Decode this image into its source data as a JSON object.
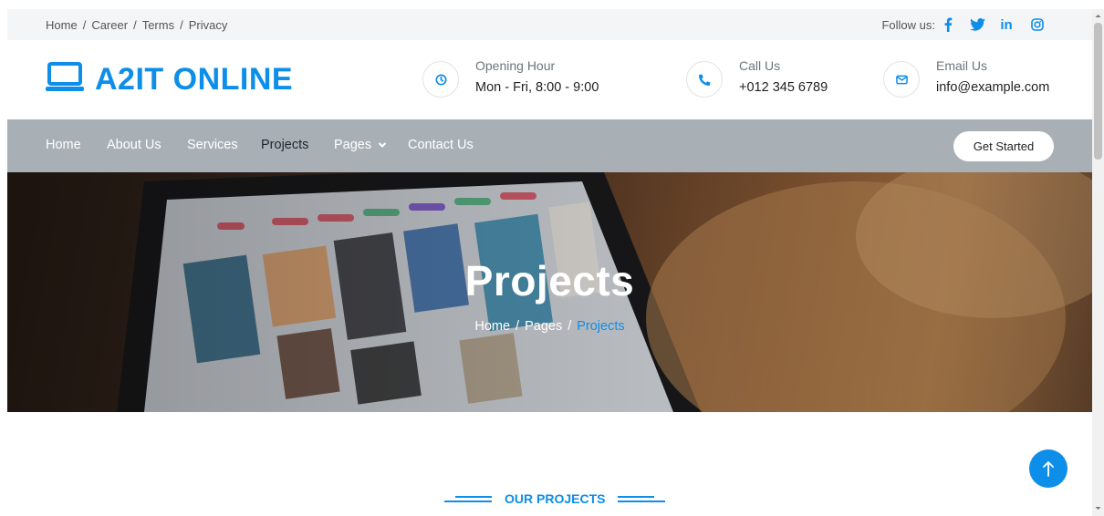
{
  "topbar": {
    "links": [
      "Home",
      "Career",
      "Terms",
      "Privacy"
    ],
    "follow_label": "Follow us:",
    "social_icons": [
      "facebook-icon",
      "twitter-icon",
      "linkedin-icon",
      "instagram-icon"
    ]
  },
  "brand": {
    "name": "A2IT ONLINE",
    "icon": "laptop-icon",
    "color": "#0d8ee9"
  },
  "contact": {
    "hours": {
      "label": "Opening Hour",
      "value": "Mon - Fri, 8:00 - 9:00",
      "icon": "clock-icon"
    },
    "phone": {
      "label": "Call Us",
      "value": "+012 345 6789",
      "icon": "phone-icon"
    },
    "email": {
      "label": "Email Us",
      "value": "info@example.com",
      "icon": "envelope-icon"
    }
  },
  "nav": {
    "items": [
      "Home",
      "About Us",
      "Services",
      "Projects",
      "Pages",
      "Contact Us"
    ],
    "active": "Projects",
    "cta": "Get Started"
  },
  "hero": {
    "title": "Projects",
    "breadcrumb": [
      "Home",
      "Pages",
      "Projects"
    ]
  },
  "section": {
    "title": "OUR PROJECTS"
  },
  "colors": {
    "accent": "#0d8ee9",
    "nav_bg": "#a9b0b5",
    "topbar_bg": "#f4f5f7"
  }
}
